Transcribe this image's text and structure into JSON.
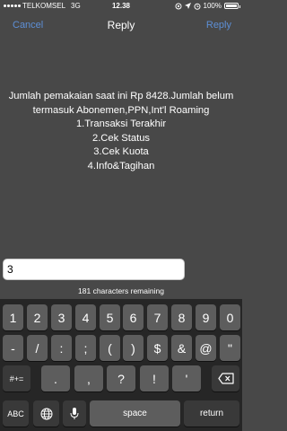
{
  "status_bar": {
    "carrier": "TELKOMSEL",
    "network": "3G",
    "time": "12.38",
    "battery_percent": "100%",
    "battery_level": 1.0
  },
  "nav": {
    "cancel_label": "Cancel",
    "title": "Reply",
    "reply_label": "Reply"
  },
  "message": {
    "lines": [
      "Jumlah pemakaian saat ini Rp 8428.Jumlah belum",
      "termasuk Abonemen,PPN,Int'l Roaming",
      "1.Transaksi Terakhir",
      "2.Cek Status",
      "3.Cek Kuota",
      "4.Info&Tagihan"
    ]
  },
  "input": {
    "value": "3",
    "counter": "181 characters remaining"
  },
  "keyboard": {
    "row1": [
      "1",
      "2",
      "3",
      "4",
      "5",
      "6",
      "7",
      "8",
      "9",
      "0"
    ],
    "row2": [
      "-",
      "/",
      ":",
      ";",
      "(",
      ")",
      "$",
      "&",
      "@",
      "\""
    ],
    "row3_left": "#+=",
    "row3": [
      ".",
      ",",
      "?",
      "!",
      "'"
    ],
    "abc": "ABC",
    "space": "space",
    "return": "return"
  }
}
